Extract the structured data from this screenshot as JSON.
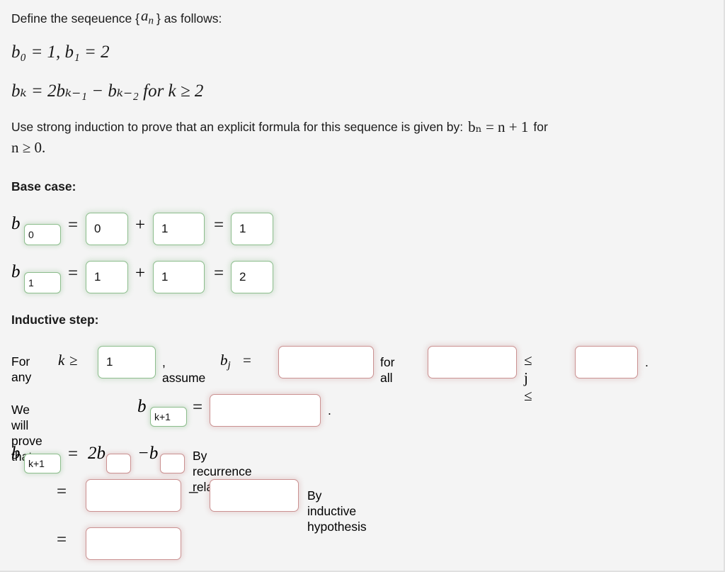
{
  "problem": {
    "intro_prefix": "Define the seqeuence {",
    "intro_var": "a",
    "intro_var_sub": "n",
    "intro_suffix": "} as follows:",
    "def_line1": "b₀ = 1, b₁ = 2",
    "def_line2": "bₖ = 2bₖ₋₁ − bₖ₋₂ for k ≥ 2",
    "instruction_part1": "Use strong induction to prove that an explicit formula for this sequence is given by:",
    "instruction_formula": "bₙ = n + 1",
    "instruction_part2": "for",
    "instruction_tail": "n ≥ 0."
  },
  "base_case": {
    "heading": "Base case:",
    "rows": [
      {
        "var": "b",
        "subscript_value": "0",
        "subscript_state": "green",
        "eq1": "=",
        "term1_value": "0",
        "term1_state": "green",
        "plus": "+",
        "term2_value": "1",
        "term2_state": "green",
        "eq2": "=",
        "result_value": "1",
        "result_state": "green"
      },
      {
        "var": "b",
        "subscript_value": "1",
        "subscript_state": "green",
        "eq1": "=",
        "term1_value": "1",
        "term1_state": "green",
        "plus": "+",
        "term2_value": "1",
        "term2_state": "green",
        "eq2": "=",
        "result_value": "2",
        "result_state": "green"
      }
    ]
  },
  "inductive_step": {
    "heading": "Inductive step:",
    "assume_line": {
      "prefix": "For any",
      "k_symbol": "k",
      "ge_symbol": "≥",
      "k_bound_value": "1",
      "k_bound_state": "green",
      "comma_assume": ", assume",
      "b_symbol": "b",
      "b_subscript": "j",
      "equals": "=",
      "formula_value": "",
      "formula_state": "red",
      "for_all": "for all",
      "lower_value": "",
      "lower_state": "red",
      "range_mid": "≤ j ≤",
      "upper_value": "",
      "upper_state": "red",
      "period": "."
    },
    "prove_line": {
      "prefix": "We will prove that",
      "b_symbol": "b",
      "subscript_value": "k+1",
      "subscript_state": "green",
      "equals": "=",
      "target_value": "",
      "target_state": "red",
      "period": "."
    },
    "derivation": [
      {
        "lhs_var": "b",
        "lhs_subscript": "k+1",
        "lhs_subscript_state": "green",
        "equals": "=",
        "coef": "2b",
        "sub1_value": "",
        "sub1_state": "red",
        "minus_b": "−b",
        "sub2_value": "",
        "sub2_state": "red",
        "justification": "By recurrence relation"
      },
      {
        "equals": "=",
        "term1_value": "",
        "term1_state": "red",
        "minus": "–",
        "term2_value": "",
        "term2_state": "red",
        "justification": "By inductive hypothesis"
      },
      {
        "equals": "=",
        "term1_value": "",
        "term1_state": "red",
        "justification": ""
      }
    ]
  },
  "colors": {
    "background": "#f4f4f4",
    "text": "#1a1a1a",
    "border_filled": "#8cbd8c",
    "border_empty": "#ca9191",
    "box_background": "#ffffff"
  }
}
